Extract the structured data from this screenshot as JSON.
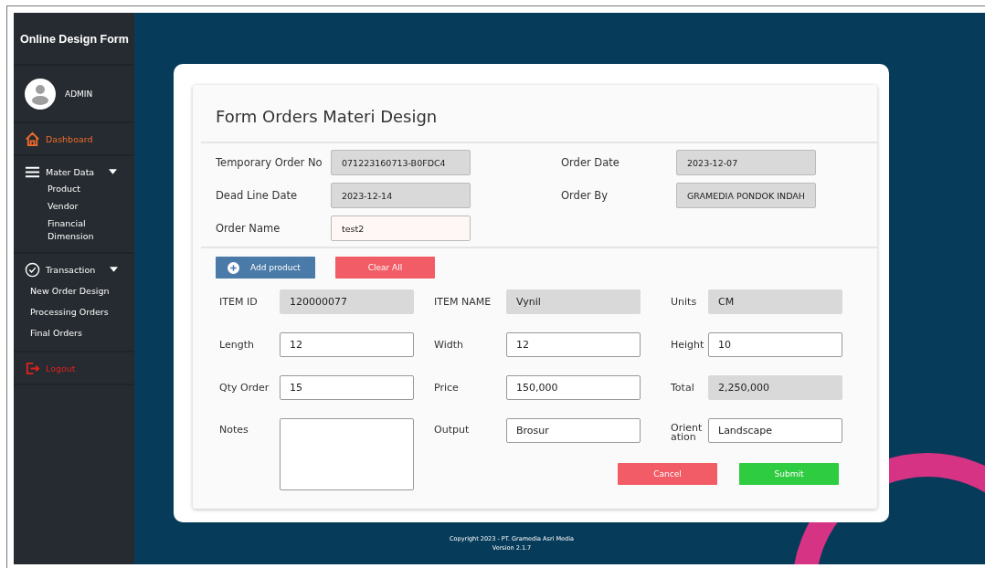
{
  "sidebar": {
    "title": "Online Design Form",
    "user": {
      "name": "ADMIN"
    },
    "items": [
      {
        "label": "Dashboard",
        "kind": "link",
        "selected": true
      },
      {
        "label": "Mater Data",
        "kind": "group",
        "expanded": true,
        "children": [
          {
            "label": "Product"
          },
          {
            "label": "Vendor"
          },
          {
            "label": "Financial Dimension"
          }
        ]
      },
      {
        "label": "Transaction",
        "kind": "group",
        "expanded": true,
        "children": [
          {
            "label": "New Order Design"
          },
          {
            "label": "Processing Orders"
          },
          {
            "label": "Final Orders"
          }
        ]
      },
      {
        "label": "Logout",
        "kind": "logout"
      }
    ]
  },
  "form": {
    "title": "Form Orders Materi Design",
    "header_fields": [
      {
        "label": "Temporary Order No",
        "value": "071223160713-B0FDC4",
        "readonly": true
      },
      {
        "label": "Order Date",
        "value": "2023-12-07",
        "readonly": true
      },
      {
        "label": "Dead Line Date",
        "value": "2023-12-14",
        "readonly": true
      },
      {
        "label": "Order By",
        "value": "GRAMEDIA PONDOK INDAH",
        "readonly": true
      },
      {
        "label": "Order Name",
        "value": "test2",
        "readonly": false
      }
    ],
    "actions": [
      {
        "label": "Add product",
        "kind": "add"
      },
      {
        "label": "Clear All",
        "kind": "danger"
      }
    ],
    "item_fields": [
      {
        "label": "ITEM ID",
        "value": "120000077",
        "kind": "readonly"
      },
      {
        "label": "ITEM NAME",
        "value": "Vynil",
        "kind": "readonly"
      },
      {
        "label": "Units",
        "value": "CM",
        "kind": "readonly"
      },
      {
        "label": "Length",
        "value": "12",
        "kind": "input"
      },
      {
        "label": "Width",
        "value": "12",
        "kind": "input"
      },
      {
        "label": "Height",
        "value": "10",
        "kind": "input"
      },
      {
        "label": "Qty Order",
        "value": "15",
        "kind": "input"
      },
      {
        "label": "Price",
        "value": "150,000",
        "kind": "input"
      },
      {
        "label": "Total",
        "value": "2,250,000",
        "kind": "readonly"
      },
      {
        "label": "Notes",
        "kind": "textarea"
      },
      {
        "label": "Output",
        "value": "Brosur",
        "kind": "input"
      },
      {
        "label": "Orient ation",
        "value": "Landscape",
        "kind": "input"
      }
    ],
    "buttons": [
      {
        "label": "Cancel",
        "kind": "danger"
      },
      {
        "label": "Submit",
        "kind": "success"
      }
    ]
  },
  "footer": {
    "copyright": "Copyright 2023 - PT. Gramedia Asri Media",
    "version": "Version 2.1.7"
  }
}
